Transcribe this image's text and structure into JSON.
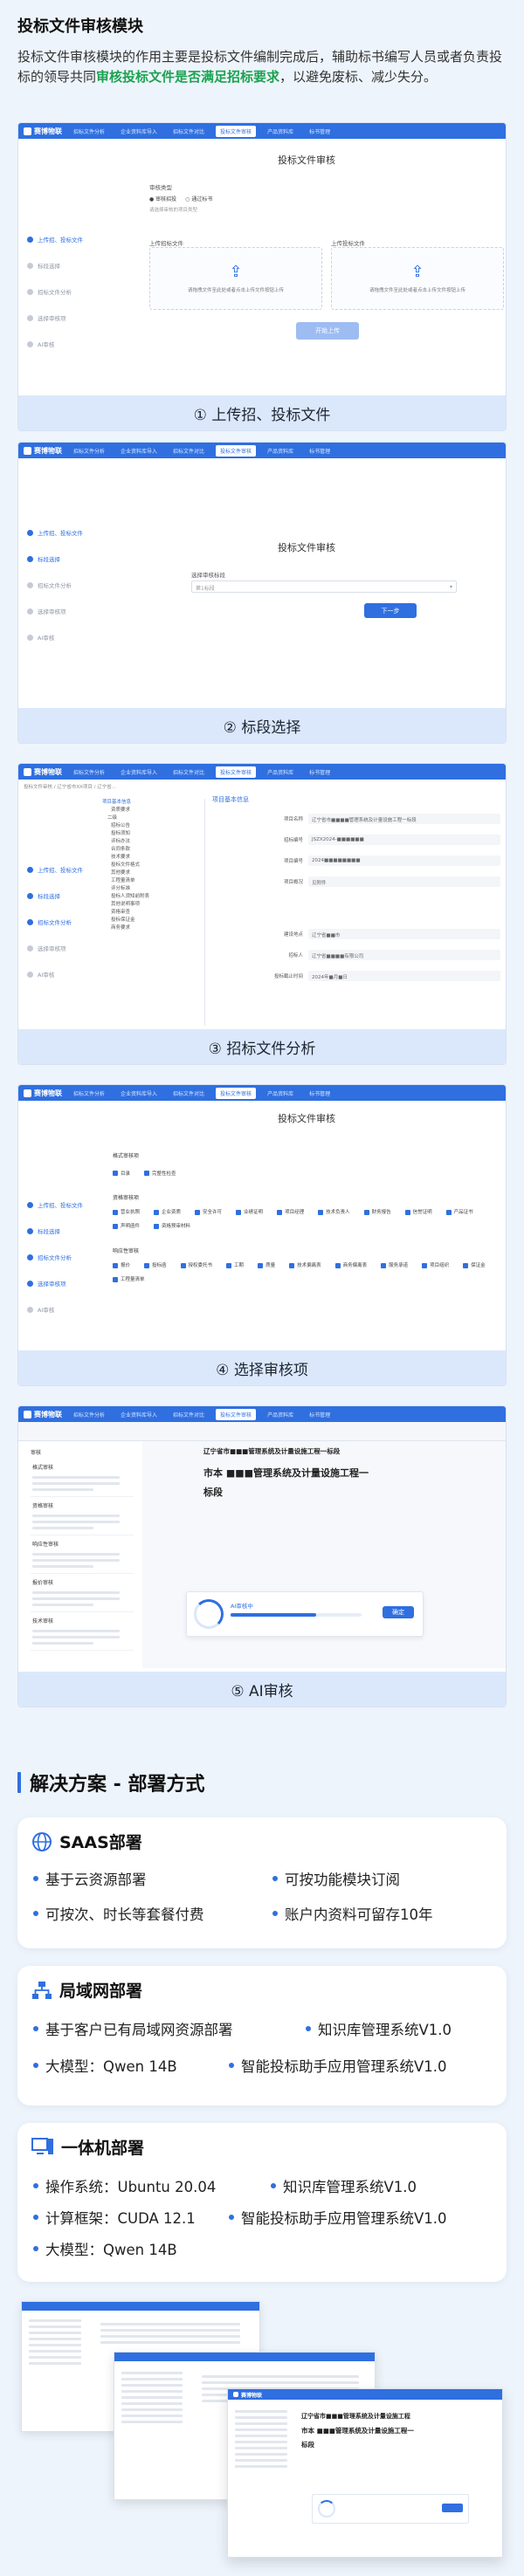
{
  "section": {
    "title": "投标文件审核模块",
    "intro_prefix": "投标文件审核模块的作用主要是投标文件编制完成后，辅助标书编写人员或者负责投标的领导共同",
    "intro_highlight": "审核投标文件是否满足招标要求",
    "intro_suffix": "，以避免废标、减少失分。"
  },
  "app": {
    "logo": "赛博物联",
    "nav": [
      "招标文件分析",
      "企业资料库导入",
      "招标文件对比",
      "投标文件审核",
      "产品资料库",
      "标书管理"
    ],
    "active_nav": "投标文件审核",
    "steps": [
      "上传招、投标文件",
      "标段选择",
      "招标文件分析",
      "选择审核项",
      "AI审核"
    ]
  },
  "panel1": {
    "title": "投标文件审核",
    "field_label": "审核类型",
    "radio_a": "审核招投",
    "radio_b": "通过标书",
    "hint": "请选择审核的项目类型",
    "upload_left_label": "上传招标文件",
    "upload_right_label": "上传投标文件",
    "upload_hint": "请拖拽文件至此处或者点击上传文件按钮上传",
    "button": "开始上传",
    "caption": "① 上传招、投标文件"
  },
  "panel2": {
    "title": "投标文件审核",
    "field_label": "选择审核标段",
    "select_placeholder": "第1标段",
    "button": "下一步",
    "caption": "② 标段选择"
  },
  "panel3": {
    "tabs": "投标文件审核 / 辽宁省市XX项目 / 辽宁省...",
    "tree_title": "项目基本信息",
    "tree": [
      "项目基本信息",
      "资质要求",
      "二级",
      "招标公告",
      "投标须知",
      "评标办法",
      "合同条款",
      "技术要求",
      "投标文件格式",
      "其他要求",
      "工程量清单",
      "评分标准",
      "投标人须知前附表",
      "其他说明事项",
      "资格审查",
      "投标保证金",
      "商务要求"
    ],
    "info_title": "项目基本信息",
    "rows": [
      {
        "k": "项目名称",
        "v": "辽宁省市■■■■管理系统及计量设施工程一标段"
      },
      {
        "k": "招标编号",
        "v": "JSZX2024-■■■■■■"
      },
      {
        "k": "项目编号",
        "v": "2024■■■■■■■■"
      },
      {
        "k": "项目概况",
        "v": "见附件"
      },
      {
        "k": "建设地点",
        "v": "辽宁省■■市"
      },
      {
        "k": "招标人",
        "v": "辽宁省■■■■有限公司"
      },
      {
        "k": "投标截止时间",
        "v": "2024年■月■日"
      }
    ],
    "caption": "③ 招标文件分析"
  },
  "panel4": {
    "title": "投标文件审核",
    "group1": "格式审核项",
    "g1_items": [
      "目录",
      "完整性检查"
    ],
    "group2": "资格审核项",
    "g2_items": [
      "营业执照",
      "企业资质",
      "安全许可",
      "业绩证明",
      "项目经理",
      "技术负责人",
      "财务报告",
      "信誉证明",
      "产品证书",
      "声明函件",
      "资格预审材料"
    ],
    "group3": "响应性审核",
    "g3_items": [
      "报价",
      "投标函",
      "授权委托书",
      "工期",
      "质量",
      "技术偏离表",
      "商务偏离表",
      "服务承诺",
      "项目组织",
      "保证金",
      "工程量清单"
    ],
    "caption": "④ 选择审核项"
  },
  "panel5": {
    "doc_heading": "辽宁省市■■■管理系统及计量设施工程一标段",
    "doc_line1": "市本 ■■■管理系统及计量设施工程一",
    "doc_line2": "标段",
    "list_title": "审核",
    "items": [
      "格式审核",
      "资格审核",
      "响应性审核",
      "报价审核",
      "技术审核"
    ],
    "progress_label": "AI审核中",
    "progress_pct": 0.65,
    "progress_button": "确定",
    "caption": "⑤ AI审核"
  },
  "solution": {
    "heading": "解决方案 - 部署方式",
    "saas": {
      "title": "SAAS部署",
      "items": [
        "基于云资源部署",
        "可按功能模块订阅",
        "可按次、时长等套餐付费",
        "账户内资料可留存10年"
      ]
    },
    "lan": {
      "title": "局域网部署",
      "items": [
        "基于客户已有局域网资源部署",
        "知识库管理系统V1.0",
        "大模型：Qwen 14B",
        "智能投标助手应用管理系统V1.0"
      ]
    },
    "aio": {
      "title": "一体机部署",
      "items": [
        "操作系统：Ubuntu 20.04",
        "知识库管理系统V1.0",
        "计算框架：CUDA 12.1",
        "智能投标助手应用管理系统V1.0",
        "大模型：Qwen 14B"
      ]
    }
  },
  "bottom": {
    "doc_line1": "辽宁省市■■■管理系统及计量设施工程",
    "doc_line2": "市本 ■■■管理系统及计量设施工程一",
    "doc_line3": "标段"
  }
}
